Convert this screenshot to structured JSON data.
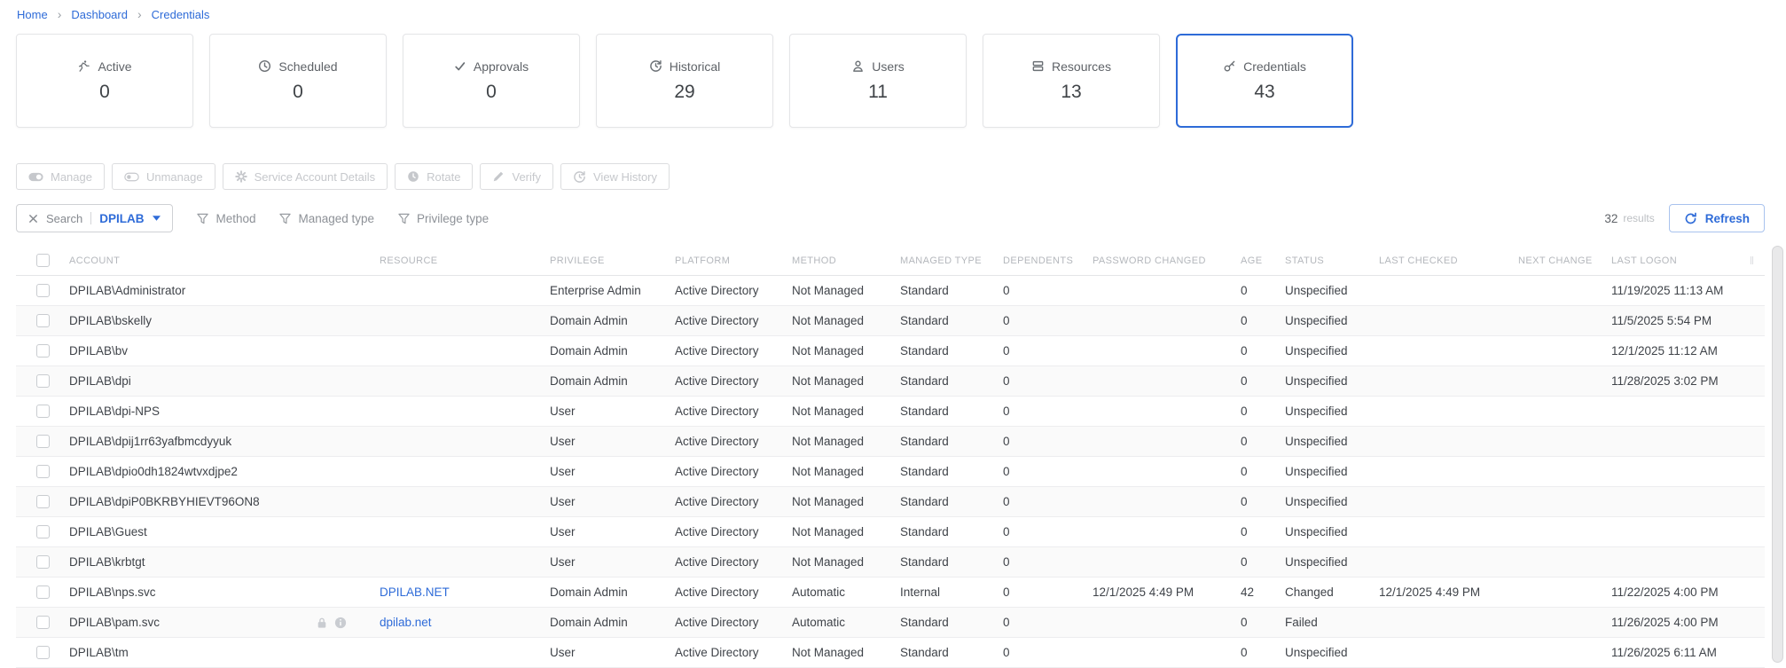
{
  "colors": {
    "accent": "#2e6bd8",
    "link": "#2e6bd8",
    "disabled_text": "#c6c8cc",
    "header_text": "#b4b7bc",
    "body_text": "#3f4349"
  },
  "breadcrumb": {
    "items": [
      "Home",
      "Dashboard",
      "Credentials"
    ]
  },
  "summary_cards": [
    {
      "id": "active",
      "label": "Active",
      "value": "0",
      "icon": "running-icon",
      "selected": false
    },
    {
      "id": "scheduled",
      "label": "Scheduled",
      "value": "0",
      "icon": "clock-icon",
      "selected": false
    },
    {
      "id": "approvals",
      "label": "Approvals",
      "value": "0",
      "icon": "check-icon",
      "selected": false
    },
    {
      "id": "historical",
      "label": "Historical",
      "value": "29",
      "icon": "history-icon",
      "selected": false
    },
    {
      "id": "users",
      "label": "Users",
      "value": "11",
      "icon": "user-icon",
      "selected": false
    },
    {
      "id": "resources",
      "label": "Resources",
      "value": "13",
      "icon": "resources-icon",
      "selected": false
    },
    {
      "id": "credentials",
      "label": "Credentials",
      "value": "43",
      "icon": "key-icon",
      "selected": true
    }
  ],
  "toolbar": {
    "buttons": [
      {
        "id": "manage",
        "label": "Manage",
        "icon": "toggle-on-icon",
        "disabled": true
      },
      {
        "id": "unmanage",
        "label": "Unmanage",
        "icon": "toggle-off-icon",
        "disabled": true
      },
      {
        "id": "service-account-details",
        "label": "Service Account Details",
        "icon": "gear-icon",
        "disabled": true
      },
      {
        "id": "rotate",
        "label": "Rotate",
        "icon": "rotate-icon",
        "disabled": true
      },
      {
        "id": "verify",
        "label": "Verify",
        "icon": "pen-icon",
        "disabled": true
      },
      {
        "id": "view-history",
        "label": "View History",
        "icon": "history-icon",
        "disabled": true
      }
    ]
  },
  "filters": {
    "search": {
      "label": "Search",
      "value": "DPILAB"
    },
    "chips": [
      {
        "id": "method",
        "label": "Method"
      },
      {
        "id": "managed-type",
        "label": "Managed type"
      },
      {
        "id": "privilege-type",
        "label": "Privilege type"
      }
    ],
    "results_count": "32",
    "results_label": "results",
    "refresh_label": "Refresh"
  },
  "table": {
    "columns": [
      "ACCOUNT",
      "RESOURCE",
      "PRIVILEGE",
      "PLATFORM",
      "METHOD",
      "MANAGED TYPE",
      "DEPENDENTS",
      "PASSWORD CHANGED",
      "AGE",
      "STATUS",
      "LAST CHECKED",
      "NEXT CHANGE",
      "LAST LOGON"
    ],
    "rows": [
      {
        "account": "DPILAB\\Administrator",
        "resource": "",
        "privilege": "Enterprise Admin",
        "platform": "Active Directory",
        "method": "Not Managed",
        "managed_type": "Standard",
        "dependents": "0",
        "password_changed": "",
        "age": "0",
        "status": "Unspecified",
        "last_checked": "",
        "next_change": "",
        "last_logon": "11/19/2025 11:13 AM"
      },
      {
        "account": "DPILAB\\bskelly",
        "resource": "",
        "privilege": "Domain Admin",
        "platform": "Active Directory",
        "method": "Not Managed",
        "managed_type": "Standard",
        "dependents": "0",
        "password_changed": "",
        "age": "0",
        "status": "Unspecified",
        "last_checked": "",
        "next_change": "",
        "last_logon": "11/5/2025 5:54 PM"
      },
      {
        "account": "DPILAB\\bv",
        "resource": "",
        "privilege": "Domain Admin",
        "platform": "Active Directory",
        "method": "Not Managed",
        "managed_type": "Standard",
        "dependents": "0",
        "password_changed": "",
        "age": "0",
        "status": "Unspecified",
        "last_checked": "",
        "next_change": "",
        "last_logon": "12/1/2025 11:12 AM"
      },
      {
        "account": "DPILAB\\dpi",
        "resource": "",
        "privilege": "Domain Admin",
        "platform": "Active Directory",
        "method": "Not Managed",
        "managed_type": "Standard",
        "dependents": "0",
        "password_changed": "",
        "age": "0",
        "status": "Unspecified",
        "last_checked": "",
        "next_change": "",
        "last_logon": "11/28/2025 3:02 PM"
      },
      {
        "account": "DPILAB\\dpi-NPS",
        "resource": "",
        "privilege": "User",
        "platform": "Active Directory",
        "method": "Not Managed",
        "managed_type": "Standard",
        "dependents": "0",
        "password_changed": "",
        "age": "0",
        "status": "Unspecified",
        "last_checked": "",
        "next_change": "",
        "last_logon": ""
      },
      {
        "account": "DPILAB\\dpij1rr63yafbmcdyyuk",
        "resource": "",
        "privilege": "User",
        "platform": "Active Directory",
        "method": "Not Managed",
        "managed_type": "Standard",
        "dependents": "0",
        "password_changed": "",
        "age": "0",
        "status": "Unspecified",
        "last_checked": "",
        "next_change": "",
        "last_logon": ""
      },
      {
        "account": "DPILAB\\dpio0dh1824wtvxdjpe2",
        "resource": "",
        "privilege": "User",
        "platform": "Active Directory",
        "method": "Not Managed",
        "managed_type": "Standard",
        "dependents": "0",
        "password_changed": "",
        "age": "0",
        "status": "Unspecified",
        "last_checked": "",
        "next_change": "",
        "last_logon": ""
      },
      {
        "account": "DPILAB\\dpiP0BKRBYHIEVT96ON8",
        "resource": "",
        "privilege": "User",
        "platform": "Active Directory",
        "method": "Not Managed",
        "managed_type": "Standard",
        "dependents": "0",
        "password_changed": "",
        "age": "0",
        "status": "Unspecified",
        "last_checked": "",
        "next_change": "",
        "last_logon": ""
      },
      {
        "account": "DPILAB\\Guest",
        "resource": "",
        "privilege": "User",
        "platform": "Active Directory",
        "method": "Not Managed",
        "managed_type": "Standard",
        "dependents": "0",
        "password_changed": "",
        "age": "0",
        "status": "Unspecified",
        "last_checked": "",
        "next_change": "",
        "last_logon": ""
      },
      {
        "account": "DPILAB\\krbtgt",
        "resource": "",
        "privilege": "User",
        "platform": "Active Directory",
        "method": "Not Managed",
        "managed_type": "Standard",
        "dependents": "0",
        "password_changed": "",
        "age": "0",
        "status": "Unspecified",
        "last_checked": "",
        "next_change": "",
        "last_logon": ""
      },
      {
        "account": "DPILAB\\nps.svc",
        "resource": "DPILAB.NET",
        "privilege": "Domain Admin",
        "platform": "Active Directory",
        "method": "Automatic",
        "managed_type": "Internal",
        "dependents": "0",
        "password_changed": "12/1/2025 4:49 PM",
        "age": "42",
        "status": "Changed",
        "last_checked": "12/1/2025 4:49 PM",
        "next_change": "",
        "last_logon": "11/22/2025 4:00 PM"
      },
      {
        "account": "DPILAB\\pam.svc",
        "resource": "dpilab.net",
        "badges": [
          "lock-icon",
          "info-icon"
        ],
        "privilege": "Domain Admin",
        "platform": "Active Directory",
        "method": "Automatic",
        "managed_type": "Standard",
        "dependents": "0",
        "password_changed": "",
        "age": "0",
        "status": "Failed",
        "last_checked": "",
        "next_change": "",
        "last_logon": "11/26/2025 4:00 PM"
      },
      {
        "account": "DPILAB\\tm",
        "resource": "",
        "privilege": "User",
        "platform": "Active Directory",
        "method": "Not Managed",
        "managed_type": "Standard",
        "dependents": "0",
        "password_changed": "",
        "age": "0",
        "status": "Unspecified",
        "last_checked": "",
        "next_change": "",
        "last_logon": "11/26/2025 6:11 AM"
      }
    ]
  }
}
